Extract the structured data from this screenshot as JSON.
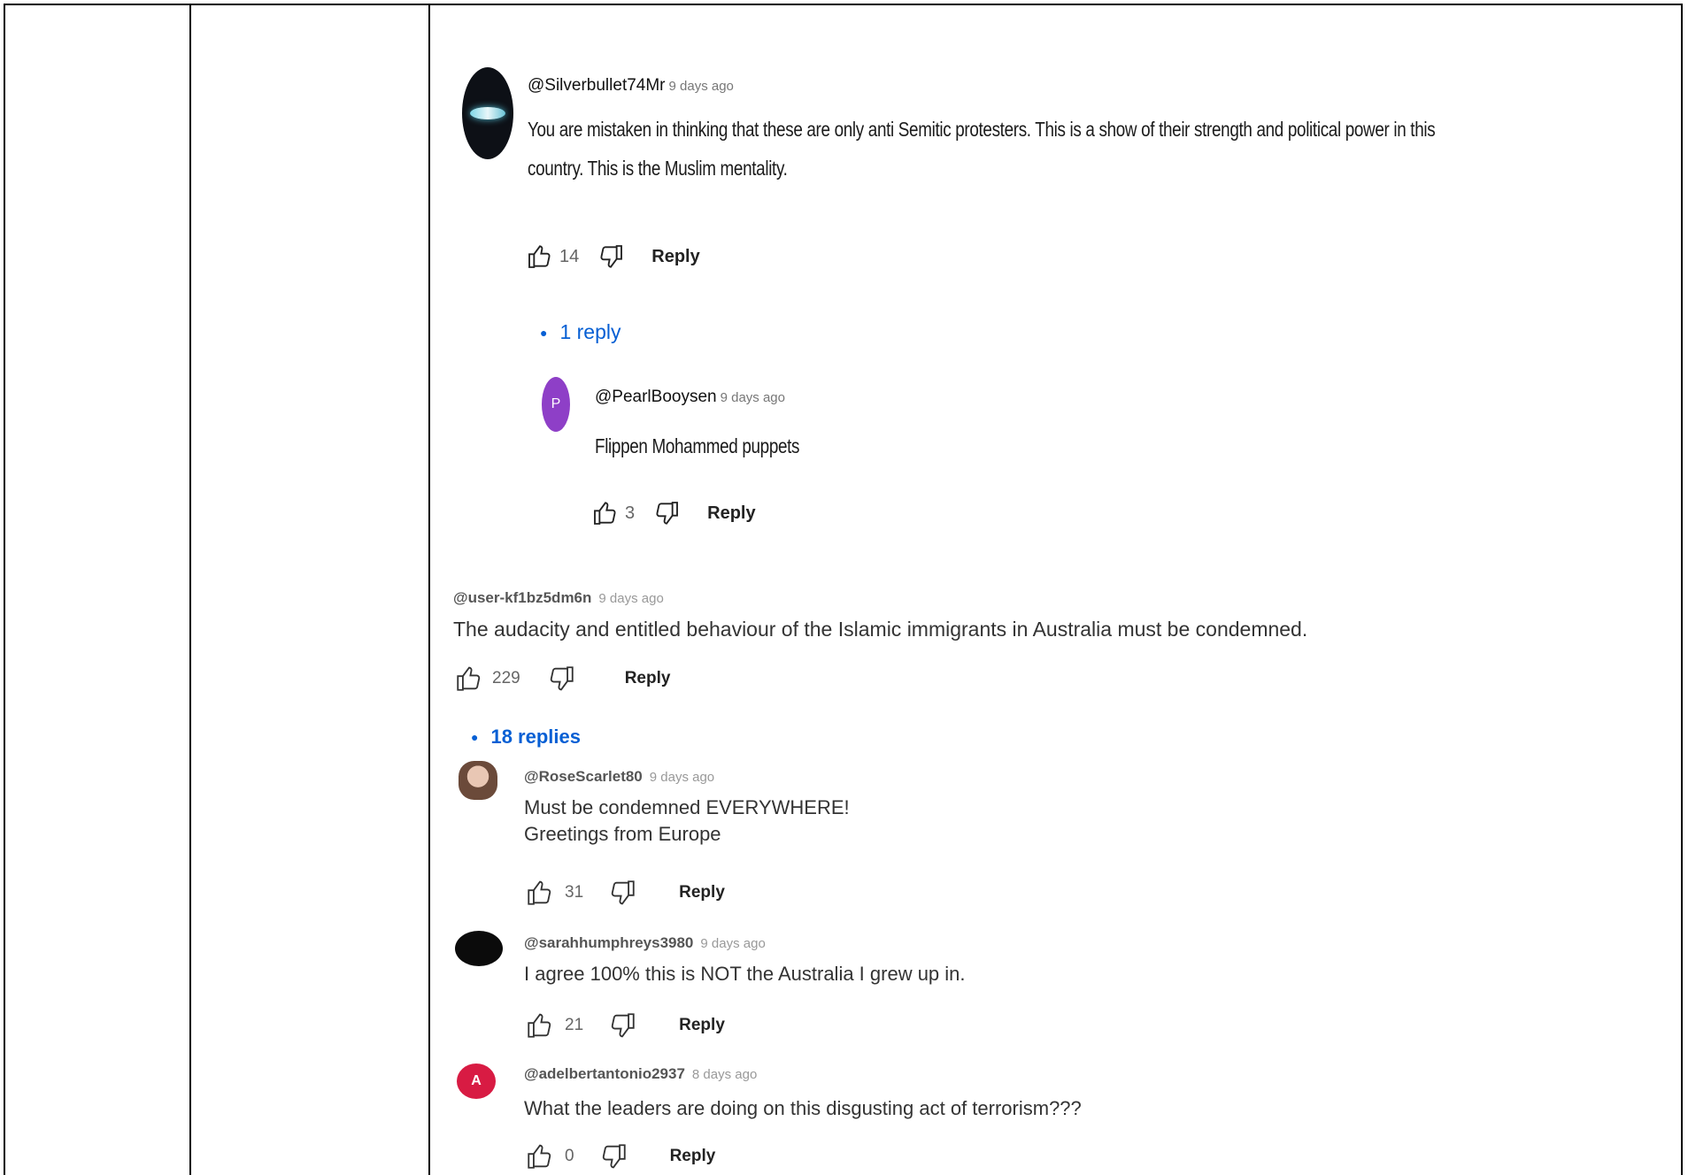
{
  "comments": [
    {
      "handle": "@Silverbullet74Mr",
      "time": "9 days ago",
      "text_lines": [
        "You are mistaken in thinking that these are only anti Semitic protesters.  This is a show of their strength and political power in this",
        "country. This is the Muslim mentality."
      ],
      "likes": "14",
      "reply_label": "Reply",
      "replies_toggle": "1 reply",
      "replies": [
        {
          "handle": "@PearlBooysen",
          "time": "9 days ago",
          "avatar_letter": "P",
          "text_lines": [
            "Flippen Mohammed puppets"
          ],
          "likes": "3",
          "reply_label": "Reply"
        }
      ]
    },
    {
      "handle": "@user-kf1bz5dm6n",
      "time": "9 days ago",
      "text_lines": [
        "The audacity and entitled behaviour of the Islamic immigrants in Australia must be condemned."
      ],
      "likes": "229",
      "reply_label": "Reply",
      "replies_toggle": "18 replies",
      "replies": [
        {
          "handle": "@RoseScarlet80",
          "time": "9 days ago",
          "text_lines": [
            "Must be condemned EVERYWHERE!",
            "Greetings from Europe"
          ],
          "likes": "31",
          "reply_label": "Reply"
        },
        {
          "handle": "@sarahhumphreys3980",
          "time": "9 days ago",
          "text_lines": [
            "I agree 100% this is NOT the Australia I grew up in."
          ],
          "likes": "21",
          "reply_label": "Reply"
        },
        {
          "handle": "@adelbertantonio2937",
          "time": "8 days ago",
          "avatar_letter": "A",
          "text_lines": [
            "What the leaders are doing on this disgusting act of terrorism???"
          ],
          "likes": "0",
          "reply_label": "Reply"
        }
      ]
    }
  ],
  "icons": {
    "like": "thumbs-up-icon",
    "dislike": "thumbs-down-icon",
    "toggle": "bullet-icon"
  },
  "colors": {
    "link": "#065fd4",
    "avatar_pearl": "#8e3fc7",
    "avatar_adelbert": "#d81b43"
  }
}
